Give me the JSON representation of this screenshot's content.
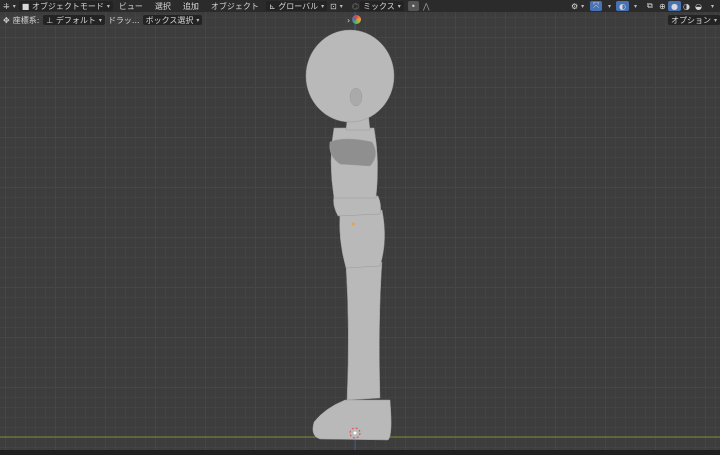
{
  "header": {
    "mode": "オブジェクトモード",
    "menus": [
      "ビュー",
      "選択",
      "追加",
      "オブジェクト"
    ],
    "orientation": "グローバル",
    "blend": "ミックス"
  },
  "toolbar": {
    "coord_label": "座標系:",
    "coord_value": "デフォルト",
    "drag_label": "ドラッ...",
    "select_mode": "ボックス選択",
    "options": "オプション"
  },
  "colors": {
    "accent": "#4772b3",
    "x_axis": "#8a9a3a",
    "z_axis": "#3d5a8a",
    "background": "#3d3d3d"
  }
}
